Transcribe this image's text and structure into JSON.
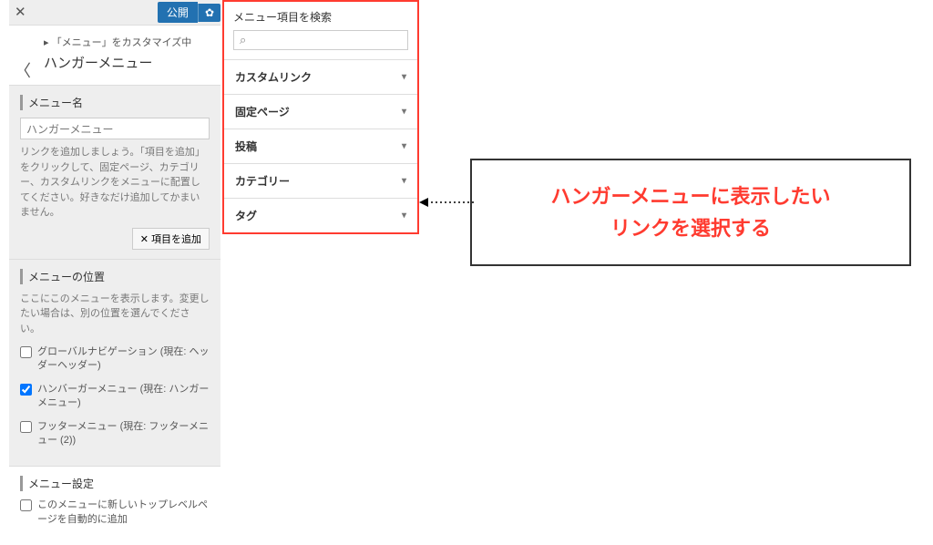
{
  "topbar": {
    "publish_label": "公開",
    "gear_icon": "gear"
  },
  "header": {
    "breadcrumb": "▸ 「メニュー」をカスタマイズ中",
    "title": "ハンガーメニュー"
  },
  "menu_name": {
    "section_label": "メニュー名",
    "value": "ハンガーメニュー",
    "help": "リンクを追加しましょう。「項目を追加」をクリックして、固定ページ、カテゴリー、カスタムリンクをメニューに配置してください。好きなだけ追加してかまいません。",
    "add_button": "✕  項目を追加"
  },
  "menu_location": {
    "section_label": "メニューの位置",
    "help": "ここにこのメニューを表示します。変更したい場合は、別の位置を選んでください。",
    "options": [
      {
        "label": "グローバルナビゲーション (現在: ヘッダーヘッダー)",
        "checked": false
      },
      {
        "label": "ハンバーガーメニュー (現在: ハンガーメニュー)",
        "checked": true
      },
      {
        "label": "フッターメニュー (現在: フッターメニュー (2))",
        "checked": false
      }
    ]
  },
  "menu_settings": {
    "section_label": "メニュー設定",
    "auto_add": {
      "label": "このメニューに新しいトップレベルページを自動的に追加",
      "checked": false
    }
  },
  "panel2": {
    "search_label": "メニュー項目を検索",
    "search_placeholder": "",
    "items": [
      "カスタムリンク",
      "固定ページ",
      "投稿",
      "カテゴリー",
      "タグ"
    ]
  },
  "callout": {
    "line1": "ハンガーメニューに表示したい",
    "line2": "リンクを選択する"
  },
  "colors": {
    "accent_red": "#ff3b30",
    "wp_blue": "#2271b1"
  }
}
